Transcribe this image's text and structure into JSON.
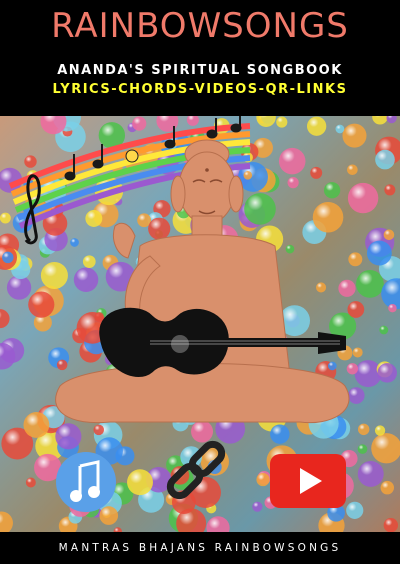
{
  "cover": {
    "title": "RAINBOWSONGS",
    "subtitle": "ANANDA'S SPIRITUAL SONGBOOK",
    "tagline": "LYRICS-CHORDS-VIDEOS-QR-LINKS",
    "footer": "MANTRAS BHAJANS RAINBOWSONGS"
  },
  "colors": {
    "title": "#f07a6a",
    "subtitle": "#ffffff",
    "tagline": "#ffff33",
    "background": "#000000",
    "buddha": "#d9906c",
    "music_icon": "#5aa0e8",
    "link_icon": "#222222",
    "video_icon": "#e8261e"
  },
  "icons": [
    "music-note-icon",
    "link-chain-icon",
    "video-play-icon"
  ]
}
